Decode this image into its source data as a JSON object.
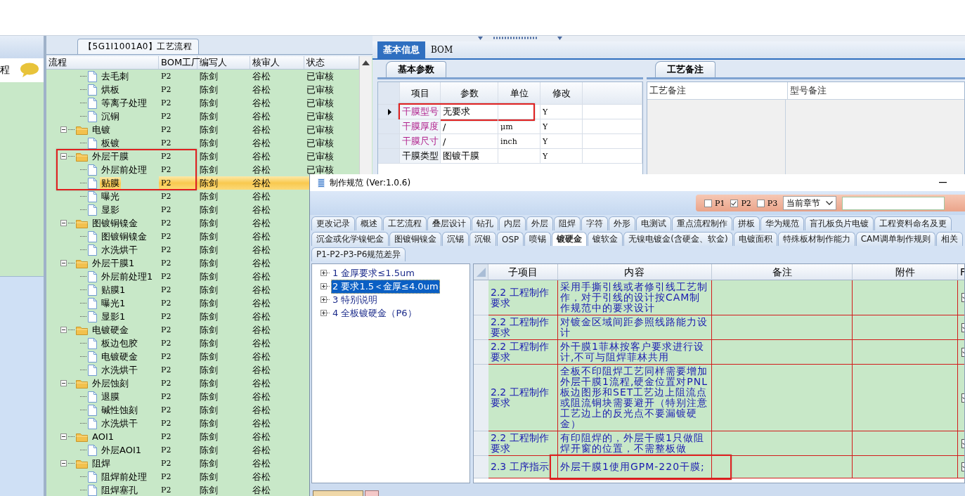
{
  "sidebar": {
    "title": "程"
  },
  "flow_panel": {
    "tab": "【5G1I1001A0】工艺流程",
    "columns": [
      "流程",
      "BOM工厂",
      "编写人",
      "核审人",
      "状态"
    ],
    "rows": [
      {
        "kind": "offscreen",
        "children": [
          {
            "kind": "step",
            "label": "去毛刺",
            "factory": "P2",
            "author": "陈剑",
            "reviewer": "谷松",
            "status": "已审核",
            "selected": false
          },
          {
            "kind": "step",
            "label": "烘板",
            "factory": "P2",
            "author": "陈剑",
            "reviewer": "谷松",
            "status": "已审核",
            "selected": false
          },
          {
            "kind": "step",
            "label": "等离子处理",
            "factory": "P2",
            "author": "陈剑",
            "reviewer": "谷松",
            "status": "已审核",
            "selected": false
          },
          {
            "kind": "step",
            "label": "沉铜",
            "factory": "P2",
            "author": "陈剑",
            "reviewer": "谷松",
            "status": "已审核",
            "selected": false
          }
        ]
      },
      {
        "kind": "folder",
        "label": "电镀",
        "factory": "P2",
        "author": "陈剑",
        "reviewer": "谷松",
        "status": "已审核",
        "expanded": true,
        "selected": false,
        "children": [
          {
            "kind": "step",
            "label": "板镀",
            "factory": "P2",
            "author": "陈剑",
            "reviewer": "谷松",
            "status": "已审核",
            "selected": false
          }
        ]
      },
      {
        "kind": "folder",
        "label": "外层干膜",
        "factory": "P2",
        "author": "陈剑",
        "reviewer": "谷松",
        "status": "已审核",
        "expanded": true,
        "selected": false,
        "children": [
          {
            "kind": "step",
            "label": "外层前处理",
            "factory": "P2",
            "author": "陈剑",
            "reviewer": "谷松",
            "status": "已审核",
            "selected": false
          },
          {
            "kind": "step",
            "label": "贴膜",
            "factory": "P2",
            "author": "陈剑",
            "reviewer": "谷松",
            "selected": true
          },
          {
            "kind": "step",
            "label": "曝光",
            "factory": "P2",
            "author": "陈剑",
            "reviewer": "谷松",
            "selected": false
          },
          {
            "kind": "step",
            "label": "显影",
            "factory": "P2",
            "author": "陈剑",
            "reviewer": "谷松",
            "selected": false
          }
        ]
      },
      {
        "kind": "folder",
        "label": "图镀铜镍金",
        "factory": "P2",
        "author": "陈剑",
        "reviewer": "谷松",
        "expanded": true,
        "selected": false,
        "children": [
          {
            "kind": "step",
            "label": "图镀铜镍金",
            "factory": "P2",
            "author": "陈剑",
            "reviewer": "谷松",
            "selected": false
          },
          {
            "kind": "step",
            "label": "水洗烘干",
            "factory": "P2",
            "author": "陈剑",
            "reviewer": "谷松",
            "selected": false
          }
        ]
      },
      {
        "kind": "folder",
        "label": "外层干膜1",
        "factory": "P2",
        "author": "陈剑",
        "reviewer": "谷松",
        "expanded": true,
        "selected": false,
        "children": [
          {
            "kind": "step",
            "label": "外层前处理1",
            "factory": "P2",
            "author": "陈剑",
            "reviewer": "谷松",
            "selected": false
          },
          {
            "kind": "step",
            "label": "贴膜1",
            "factory": "P2",
            "author": "陈剑",
            "reviewer": "谷松",
            "selected": false
          },
          {
            "kind": "step",
            "label": "曝光1",
            "factory": "P2",
            "author": "陈剑",
            "reviewer": "谷松",
            "selected": false
          },
          {
            "kind": "step",
            "label": "显影1",
            "factory": "P2",
            "author": "陈剑",
            "reviewer": "谷松",
            "selected": false
          }
        ]
      },
      {
        "kind": "folder",
        "label": "电镀硬金",
        "factory": "P2",
        "author": "陈剑",
        "reviewer": "谷松",
        "expanded": true,
        "selected": false,
        "children": [
          {
            "kind": "step",
            "label": "板边包胶",
            "factory": "P2",
            "author": "陈剑",
            "reviewer": "谷松",
            "selected": false
          },
          {
            "kind": "step",
            "label": "电镀硬金",
            "factory": "P2",
            "author": "陈剑",
            "reviewer": "谷松",
            "selected": false
          },
          {
            "kind": "step",
            "label": "水洗烘干",
            "factory": "P2",
            "author": "陈剑",
            "reviewer": "谷松",
            "selected": false
          }
        ]
      },
      {
        "kind": "folder",
        "label": "外层蚀刻",
        "factory": "P2",
        "author": "陈剑",
        "reviewer": "谷松",
        "expanded": true,
        "selected": false,
        "children": [
          {
            "kind": "step",
            "label": "退膜",
            "factory": "P2",
            "author": "陈剑",
            "reviewer": "谷松",
            "selected": false
          },
          {
            "kind": "step",
            "label": "碱性蚀刻",
            "factory": "P2",
            "author": "陈剑",
            "reviewer": "谷松",
            "selected": false
          },
          {
            "kind": "step",
            "label": "水洗烘干",
            "factory": "P2",
            "author": "陈剑",
            "reviewer": "谷松",
            "selected": false
          }
        ]
      },
      {
        "kind": "folder",
        "label": "AOI1",
        "factory": "P2",
        "author": "陈剑",
        "reviewer": "谷松",
        "expanded": true,
        "selected": false,
        "children": [
          {
            "kind": "step",
            "label": "外层AOI1",
            "factory": "P2",
            "author": "陈剑",
            "reviewer": "谷松",
            "selected": false
          }
        ]
      },
      {
        "kind": "folder",
        "label": "阻焊",
        "factory": "P2",
        "author": "陈剑",
        "reviewer": "谷松",
        "expanded": true,
        "selected": false,
        "children": [
          {
            "kind": "step",
            "label": "阻焊前处理",
            "factory": "P2",
            "author": "陈剑",
            "reviewer": "谷松",
            "selected": false
          },
          {
            "kind": "step",
            "label": "阻焊塞孔",
            "factory": "P2",
            "author": "陈剑",
            "reviewer": "谷松",
            "selected": false
          }
        ]
      }
    ]
  },
  "info_panel": {
    "tabs": [
      {
        "label": "基本信息",
        "selected": true
      },
      {
        "label": "BOM",
        "selected": false
      }
    ],
    "params": {
      "tab": "基本参数",
      "columns": [
        "项目",
        "参数",
        "单位",
        "修改"
      ],
      "rows": [
        {
          "item": "干膜型号",
          "value": "无要求",
          "edit": "Y",
          "current": true,
          "annotated": true,
          "color": "#b0208c"
        },
        {
          "item": "干膜厚度",
          "value": "/",
          "unit": "μm",
          "edit": "Y",
          "current": false,
          "annotated": false,
          "color": "#b0208c"
        },
        {
          "item": "干膜尺寸",
          "value": "/",
          "unit": "inch",
          "edit": "Y",
          "current": false,
          "annotated": false,
          "color": "#b0208c"
        },
        {
          "item": "干膜类型",
          "value": "图镀干膜",
          "edit": "Y",
          "current": false,
          "annotated": false,
          "color": "#000000"
        }
      ]
    },
    "notes": {
      "tab": "工艺备注",
      "columns": [
        "工艺备注",
        "型号备注"
      ]
    }
  },
  "dialog": {
    "title": "制作规范 (Ver:1.0.6)",
    "filters": [
      {
        "label": "P1",
        "checked": false
      },
      {
        "label": "P2",
        "checked": true
      },
      {
        "label": "P3",
        "checked": false
      }
    ],
    "scope": "当前章节",
    "tab_rows": [
      [
        {
          "label": "更改记录",
          "selected": false
        },
        {
          "label": "概述",
          "selected": false
        },
        {
          "label": "工艺流程",
          "selected": false
        },
        {
          "label": "叠层设计",
          "selected": false
        },
        {
          "label": "钻孔",
          "selected": false
        },
        {
          "label": "内层",
          "selected": false
        },
        {
          "label": "外层",
          "selected": false
        },
        {
          "label": "阻焊",
          "selected": false
        },
        {
          "label": "字符",
          "selected": false
        },
        {
          "label": "外形",
          "selected": false
        },
        {
          "label": "电测试",
          "selected": false
        },
        {
          "label": "重点流程制作",
          "selected": false
        },
        {
          "label": "拼板",
          "selected": false
        },
        {
          "label": "华为规范",
          "selected": false
        },
        {
          "label": "盲孔板负片电镀",
          "selected": false
        },
        {
          "label": "工程资料命名及更",
          "selected": false
        }
      ],
      [
        {
          "label": "沉金或化学镍钯金",
          "selected": false
        },
        {
          "label": "图镀铜镍金",
          "selected": false
        },
        {
          "label": "沉锡",
          "selected": false
        },
        {
          "label": "沉银",
          "selected": false
        },
        {
          "label": "OSP",
          "selected": false
        },
        {
          "label": "喷锡",
          "selected": false
        },
        {
          "label": "镀硬金",
          "selected": true
        },
        {
          "label": "镀软金",
          "selected": false
        },
        {
          "label": "无镍电镀金(含硬金、软金)",
          "selected": false
        },
        {
          "label": "电镀面积",
          "selected": false
        },
        {
          "label": "特殊板材制作能力",
          "selected": false
        },
        {
          "label": "CAM调单制作规则",
          "selected": false
        },
        {
          "label": "相关",
          "selected": false
        }
      ],
      [
        {
          "label": "P1-P2-P3-P6规范差异",
          "selected": false
        }
      ]
    ],
    "outline": [
      {
        "label": "1 金厚要求≤1.5um",
        "expanded": false,
        "selected": false
      },
      {
        "label": "2 要求1.5＜金厚≤4.0um",
        "expanded": false,
        "selected": true
      },
      {
        "label": "3 特别说明",
        "expanded": false,
        "selected": false
      },
      {
        "label": "4 全板镀硬金（P6）",
        "expanded": false,
        "selected": false
      }
    ],
    "table": {
      "columns": [
        "子项目",
        "内容",
        "备注",
        "附件",
        "F"
      ],
      "rows": [
        {
          "sub_item": "2.2 工程制作要求",
          "content": "采用手撕引线或者修引线工艺制作，对于引线的设计按CAM制作规范中的要求设计",
          "checked": true,
          "annotated": false
        },
        {
          "sub_item": "2.2 工程制作要求",
          "content": "对镀金区域间距参照线路能力设计",
          "checked": true,
          "annotated": false
        },
        {
          "sub_item": "2.2 工程制作要求",
          "content": "外干膜1菲林按客户要求进行设计,不可与阻焊菲林共用",
          "checked": true,
          "annotated": false
        },
        {
          "sub_item": "2.2 工程制作要求",
          "content": "全板不印阻焊工艺同样需要增加外层干膜1流程,硬金位置对PNL板边图形和SET工艺边上阻流点或阻流铜块需要避开（特别注意工艺边上的反光点不要漏镀硬金）",
          "checked": true,
          "annotated": false
        },
        {
          "sub_item": "2.2 工程制作要求",
          "content": "有印阻焊的，外层干膜1只做阻焊开窗的位置，不需整板做",
          "checked": true,
          "annotated": false
        },
        {
          "sub_item": "2.3 工序指示",
          "content": "外层干膜1使用GPM-220干膜;",
          "checked": true,
          "annotated": true
        }
      ]
    }
  }
}
